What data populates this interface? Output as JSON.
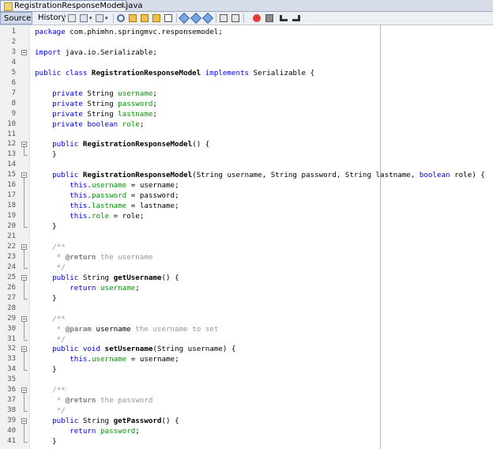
{
  "tab": {
    "title": "RegistrationResponseModel.java",
    "close": "×"
  },
  "toolbar": {
    "source_label": "Source",
    "history_label": "History"
  },
  "editor": {
    "lines": [
      {
        "n": "1",
        "fold": false,
        "segs": [
          [
            "kw",
            "package"
          ],
          [
            "t",
            " com.phimhn.springmvc.responsemodel;"
          ]
        ]
      },
      {
        "n": "2",
        "fold": false,
        "segs": []
      },
      {
        "n": "3",
        "fold": true,
        "segs": [
          [
            "kw",
            "import"
          ],
          [
            "t",
            " java.io.Serializable;"
          ]
        ]
      },
      {
        "n": "4",
        "fold": false,
        "segs": []
      },
      {
        "n": "5",
        "fold": false,
        "segs": [
          [
            "kw",
            "public class "
          ],
          [
            "b",
            "RegistrationResponseModel"
          ],
          [
            "kw",
            " implements"
          ],
          [
            "t",
            " Serializable {"
          ]
        ]
      },
      {
        "n": "6",
        "fold": false,
        "segs": []
      },
      {
        "n": "7",
        "fold": false,
        "segs": [
          [
            "t",
            "    "
          ],
          [
            "kw",
            "private"
          ],
          [
            "t",
            " String "
          ],
          [
            "f",
            "username"
          ],
          [
            "t",
            ";"
          ]
        ]
      },
      {
        "n": "8",
        "fold": false,
        "segs": [
          [
            "t",
            "    "
          ],
          [
            "kw",
            "private"
          ],
          [
            "t",
            " String "
          ],
          [
            "f",
            "password"
          ],
          [
            "t",
            ";"
          ]
        ]
      },
      {
        "n": "9",
        "fold": false,
        "segs": [
          [
            "t",
            "    "
          ],
          [
            "kw",
            "private"
          ],
          [
            "t",
            " String "
          ],
          [
            "f",
            "lastname"
          ],
          [
            "t",
            ";"
          ]
        ]
      },
      {
        "n": "10",
        "fold": false,
        "segs": [
          [
            "t",
            "    "
          ],
          [
            "kw",
            "private boolean"
          ],
          [
            "t",
            " "
          ],
          [
            "f",
            "role"
          ],
          [
            "t",
            ";"
          ]
        ]
      },
      {
        "n": "11",
        "fold": false,
        "segs": []
      },
      {
        "n": "12",
        "fold": true,
        "segs": [
          [
            "t",
            "    "
          ],
          [
            "kw",
            "public"
          ],
          [
            "t",
            " "
          ],
          [
            "b",
            "RegistrationResponseModel"
          ],
          [
            "t",
            "() {"
          ]
        ]
      },
      {
        "n": "13",
        "fold": false,
        "segs": [
          [
            "t",
            "    }"
          ]
        ]
      },
      {
        "n": "14",
        "fold": false,
        "segs": []
      },
      {
        "n": "15",
        "fold": true,
        "segs": [
          [
            "t",
            "    "
          ],
          [
            "kw",
            "public"
          ],
          [
            "t",
            " "
          ],
          [
            "b",
            "RegistrationResponseModel"
          ],
          [
            "t",
            "(String username, String password, String lastname, "
          ],
          [
            "kw",
            "boolean"
          ],
          [
            "t",
            " role) {"
          ]
        ]
      },
      {
        "n": "16",
        "fold": false,
        "segs": [
          [
            "t",
            "        "
          ],
          [
            "kw",
            "this"
          ],
          [
            "t",
            "."
          ],
          [
            "f",
            "username"
          ],
          [
            "t",
            " = username;"
          ]
        ]
      },
      {
        "n": "17",
        "fold": false,
        "segs": [
          [
            "t",
            "        "
          ],
          [
            "kw",
            "this"
          ],
          [
            "t",
            "."
          ],
          [
            "f",
            "password"
          ],
          [
            "t",
            " = password;"
          ]
        ]
      },
      {
        "n": "18",
        "fold": false,
        "segs": [
          [
            "t",
            "        "
          ],
          [
            "kw",
            "this"
          ],
          [
            "t",
            "."
          ],
          [
            "f",
            "lastname"
          ],
          [
            "t",
            " = lastname;"
          ]
        ]
      },
      {
        "n": "19",
        "fold": false,
        "segs": [
          [
            "t",
            "        "
          ],
          [
            "kw",
            "this"
          ],
          [
            "t",
            "."
          ],
          [
            "f",
            "role"
          ],
          [
            "t",
            " = role;"
          ]
        ]
      },
      {
        "n": "20",
        "fold": false,
        "segs": [
          [
            "t",
            "    }"
          ]
        ]
      },
      {
        "n": "21",
        "fold": false,
        "segs": []
      },
      {
        "n": "22",
        "fold": true,
        "segs": [
          [
            "c",
            "    /**"
          ]
        ]
      },
      {
        "n": "23",
        "fold": false,
        "segs": [
          [
            "c",
            "     * "
          ],
          [
            "ct",
            "@return"
          ],
          [
            "c",
            " the username"
          ]
        ]
      },
      {
        "n": "24",
        "fold": false,
        "segs": [
          [
            "c",
            "     */"
          ]
        ]
      },
      {
        "n": "25",
        "fold": true,
        "segs": [
          [
            "t",
            "    "
          ],
          [
            "kw",
            "public"
          ],
          [
            "t",
            " String "
          ],
          [
            "b",
            "getUsername"
          ],
          [
            "t",
            "() {"
          ]
        ]
      },
      {
        "n": "26",
        "fold": false,
        "segs": [
          [
            "t",
            "        "
          ],
          [
            "kw",
            "return"
          ],
          [
            "t",
            " "
          ],
          [
            "f",
            "username"
          ],
          [
            "t",
            ";"
          ]
        ]
      },
      {
        "n": "27",
        "fold": false,
        "segs": [
          [
            "t",
            "    }"
          ]
        ]
      },
      {
        "n": "28",
        "fold": false,
        "segs": []
      },
      {
        "n": "29",
        "fold": true,
        "segs": [
          [
            "c",
            "    /**"
          ]
        ]
      },
      {
        "n": "30",
        "fold": false,
        "segs": [
          [
            "c",
            "     * "
          ],
          [
            "ct",
            "@param"
          ],
          [
            "t",
            " username"
          ],
          [
            "c",
            " the username to set"
          ]
        ]
      },
      {
        "n": "31",
        "fold": false,
        "segs": [
          [
            "c",
            "     */"
          ]
        ]
      },
      {
        "n": "32",
        "fold": true,
        "segs": [
          [
            "t",
            "    "
          ],
          [
            "kw",
            "public void"
          ],
          [
            "t",
            " "
          ],
          [
            "b",
            "setUsername"
          ],
          [
            "t",
            "(String username) {"
          ]
        ]
      },
      {
        "n": "33",
        "fold": false,
        "segs": [
          [
            "t",
            "        "
          ],
          [
            "kw",
            "this"
          ],
          [
            "t",
            "."
          ],
          [
            "f",
            "username"
          ],
          [
            "t",
            " = username;"
          ]
        ]
      },
      {
        "n": "34",
        "fold": false,
        "segs": [
          [
            "t",
            "    }"
          ]
        ]
      },
      {
        "n": "35",
        "fold": false,
        "segs": []
      },
      {
        "n": "36",
        "fold": true,
        "segs": [
          [
            "c",
            "    /**"
          ]
        ]
      },
      {
        "n": "37",
        "fold": false,
        "segs": [
          [
            "c",
            "     * "
          ],
          [
            "ct",
            "@return"
          ],
          [
            "c",
            " the password"
          ]
        ]
      },
      {
        "n": "38",
        "fold": false,
        "segs": [
          [
            "c",
            "     */"
          ]
        ]
      },
      {
        "n": "39",
        "fold": true,
        "segs": [
          [
            "t",
            "    "
          ],
          [
            "kw",
            "public"
          ],
          [
            "t",
            " String "
          ],
          [
            "b",
            "getPassword"
          ],
          [
            "t",
            "() {"
          ]
        ]
      },
      {
        "n": "40",
        "fold": false,
        "segs": [
          [
            "t",
            "        "
          ],
          [
            "kw",
            "return"
          ],
          [
            "t",
            " "
          ],
          [
            "f",
            "password"
          ],
          [
            "t",
            ";"
          ]
        ]
      },
      {
        "n": "41",
        "fold": false,
        "segs": [
          [
            "t",
            "    }"
          ]
        ]
      }
    ]
  }
}
